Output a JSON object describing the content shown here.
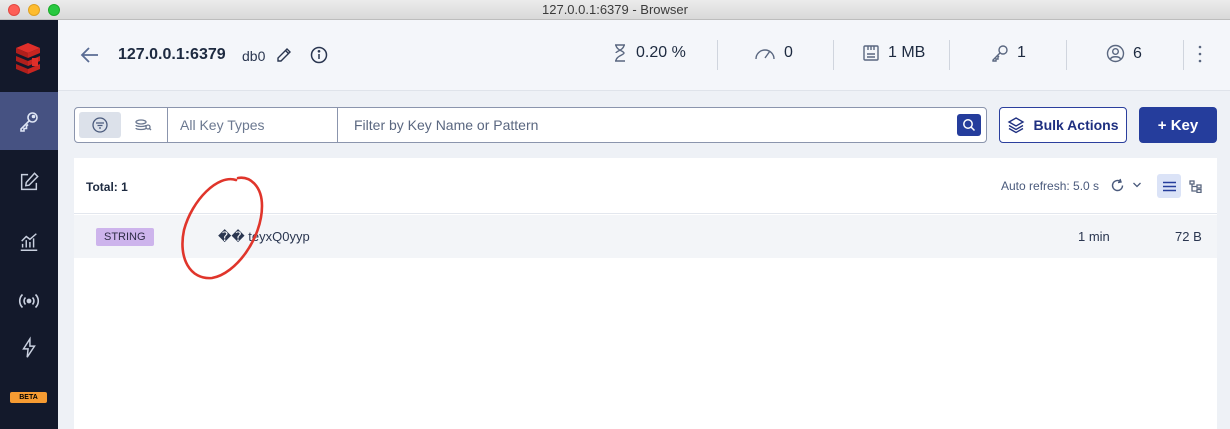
{
  "window": {
    "title": "127.0.0.1:6379 - Browser"
  },
  "header": {
    "host": "127.0.0.1:6379",
    "db": "db0",
    "stats": {
      "cpu": "0.20 %",
      "ops": "0",
      "memory": "1 MB",
      "keys": "1",
      "clients": "6"
    }
  },
  "sidebar": {
    "items": [
      {
        "icon": "key-icon",
        "active": true
      },
      {
        "icon": "edit-icon",
        "active": false
      },
      {
        "icon": "chart-icon",
        "active": false
      },
      {
        "icon": "broadcast-icon",
        "active": false
      },
      {
        "icon": "lightning-icon",
        "active": false,
        "badge": "BETA"
      }
    ]
  },
  "toolbar": {
    "key_type_select": "All Key Types",
    "search_placeholder": "Filter by Key Name or Pattern",
    "bulk_actions_label": "Bulk Actions",
    "add_key_label": "+ Key"
  },
  "list": {
    "total": "Total: 1",
    "auto_refresh": "Auto refresh: 5.0 s",
    "rows": [
      {
        "type": "STRING",
        "name": "�� teyxQ0yyp",
        "ttl": "1 min",
        "size": "72 B"
      }
    ]
  },
  "colors": {
    "sidebar_bg": "#13192b",
    "sidebar_active": "#465282",
    "primary": "#253d9c",
    "string_badge": "#cdb4ec",
    "annotation": "#e0352b"
  }
}
